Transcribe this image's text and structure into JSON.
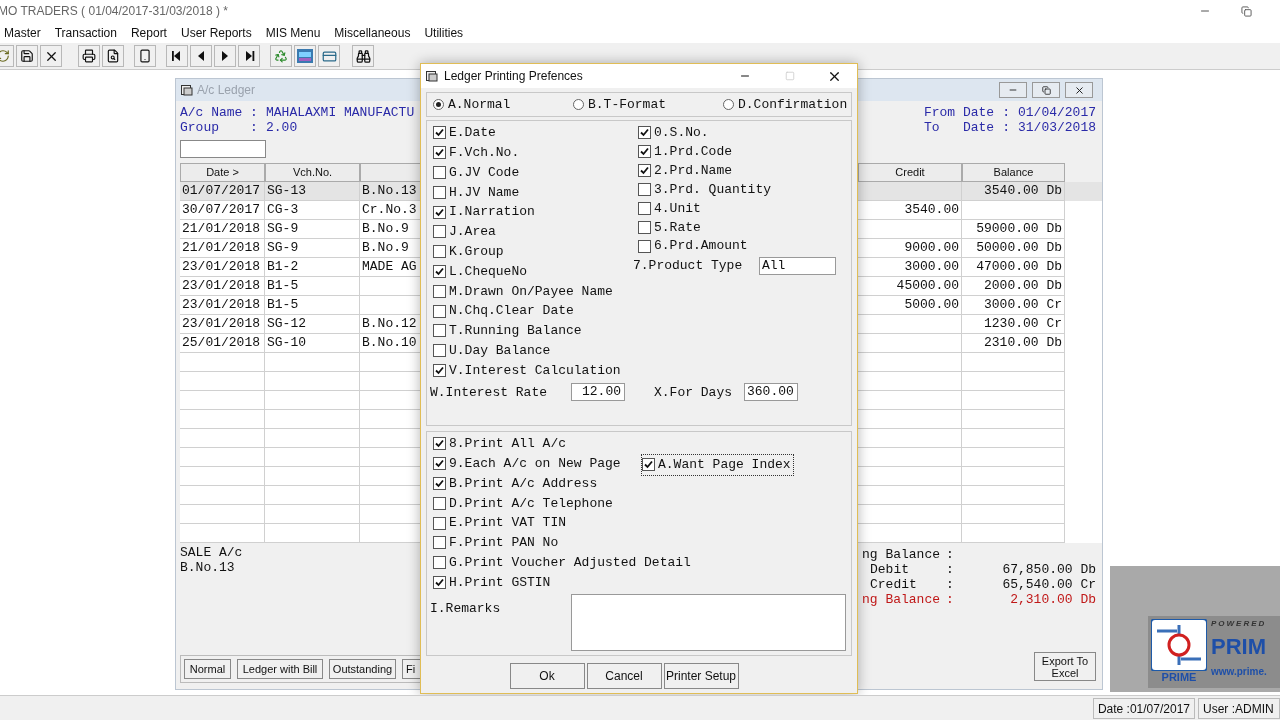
{
  "app": {
    "title": "MO TRADERS ( 01/04/2017-31/03/2018 ) *"
  },
  "menu": [
    "Master",
    "Transaction",
    "Report",
    "User Reports",
    "MIS Menu",
    "Miscellaneous",
    "Utilities"
  ],
  "ledger": {
    "title": "A/c Ledger",
    "info_left": [
      {
        "label": "A/c Name",
        "sep": ":",
        "value": "MAHALAXMI MANUFACTU"
      },
      {
        "label": "Group",
        "sep": ":",
        "value": "2.00"
      }
    ],
    "info_right": [
      {
        "label": "From Date",
        "sep": ":",
        "value": "01/04/2017"
      },
      {
        "label": "To   Date",
        "sep": ":",
        "value": "31/03/2018"
      }
    ],
    "columns": [
      {
        "label": "Date >"
      },
      {
        "label": "Vch.No."
      },
      {},
      {
        "label": "Credit"
      },
      {
        "label": "Balance"
      }
    ],
    "rows": [
      {
        "selected": true,
        "date": "01/07/2017",
        "vch_no": "SG-13",
        "column_3": "B.No.13",
        "balance": "3540.00 Db"
      },
      {
        "selected": false,
        "date": "30/07/2017",
        "vch_no": "CG-3",
        "column_3": "Cr.No.3",
        "credit": "3540.00"
      },
      {
        "selected": false,
        "date": "21/01/2018",
        "vch_no": "SG-9",
        "column_3": "B.No.9",
        "balance": "59000.00 Db"
      },
      {
        "selected": false,
        "date": "21/01/2018",
        "vch_no": "SG-9",
        "column_3": "B.No.9",
        "credit": "9000.00",
        "balance": "50000.00 Db"
      },
      {
        "selected": false,
        "date": "23/01/2018",
        "vch_no": "B1-2",
        "column_3": "MADE AG",
        "credit": "3000.00",
        "balance": "47000.00 Db"
      },
      {
        "selected": false,
        "date": "23/01/2018",
        "vch_no": "B1-5",
        "credit": "45000.00",
        "balance": "2000.00 Db"
      },
      {
        "selected": false,
        "date": "23/01/2018",
        "vch_no": "B1-5",
        "credit": "5000.00",
        "balance": "3000.00 Cr"
      },
      {
        "selected": false,
        "date": "23/01/2018",
        "vch_no": "SG-12",
        "column_3": "B.No.12",
        "balance": "1230.00 Cr"
      },
      {
        "selected": false,
        "date": "25/01/2018",
        "vch_no": "SG-10",
        "column_3": "B.No.10",
        "balance": "2310.00 Db"
      }
    ],
    "narration": [
      "SALE A/c",
      "B.No.13"
    ],
    "summary": [
      {
        "kind": "heading",
        "label": "ng Balance",
        "sep": ":"
      },
      {
        "kind": "entry",
        "label": "Debit",
        "sep": ":",
        "value": "67,850.00 Db"
      },
      {
        "kind": "entry",
        "label": "Credit",
        "sep": ":",
        "value": "65,540.00 Cr"
      },
      {
        "kind": "result",
        "label": "ng Balance",
        "sep": ":",
        "value": "2,310.00 Db"
      }
    ],
    "view_buttons": [
      "Normal",
      "Ledger with Bill",
      "Outstanding",
      "Fi"
    ],
    "export_button": "Export To Excel"
  },
  "dialog": {
    "title": "Ledger Printing Prefences",
    "formats": [
      {
        "label": "A.Normal",
        "selected": true
      },
      {
        "label": "B.T-Format",
        "selected": false
      },
      {
        "label": "D.Confirmation",
        "selected": false
      }
    ],
    "columns_left": [
      {
        "label": "E.Date",
        "checked": true
      },
      {
        "label": "F.Vch.No.",
        "checked": true
      },
      {
        "label": "G.JV Code",
        "checked": false
      },
      {
        "label": "H.JV Name",
        "checked": false
      },
      {
        "label": "I.Narration",
        "checked": true
      },
      {
        "label": "J.Area",
        "checked": false
      },
      {
        "label": "K.Group",
        "checked": false
      },
      {
        "label": "L.ChequeNo",
        "checked": true
      },
      {
        "label": "M.Drawn On/Payee Name",
        "checked": false
      },
      {
        "label": "N.Chq.Clear Date",
        "checked": false
      },
      {
        "label": "T.Running Balance",
        "checked": false
      },
      {
        "label": "U.Day Balance",
        "checked": false
      },
      {
        "label": "V.Interest Calculation",
        "checked": true
      }
    ],
    "columns_right": [
      {
        "label": "0.S.No.",
        "checked": true
      },
      {
        "label": "1.Prd.Code",
        "checked": true
      },
      {
        "label": "2.Prd.Name",
        "checked": true
      },
      {
        "label": "3.Prd. Quantity",
        "checked": false
      },
      {
        "label": "4.Unit",
        "checked": false
      },
      {
        "label": "5.Rate",
        "checked": false
      },
      {
        "label": "6.Prd.Amount",
        "checked": false
      }
    ],
    "product_type": {
      "label": "7.Product Type",
      "value": "All"
    },
    "interest_rate": {
      "label": "W.Interest Rate",
      "value": "12.00"
    },
    "for_days": {
      "label": "X.For Days",
      "value": "360.00"
    },
    "print_options": [
      {
        "label": "8.Print All A/c",
        "checked": true
      },
      {
        "label": "9.Each A/c on New Page",
        "checked": true
      },
      {
        "label": "B.Print A/c Address",
        "checked": true
      },
      {
        "label": "D.Print A/c Telephone",
        "checked": false
      },
      {
        "label": "E.Print VAT TIN",
        "checked": false
      },
      {
        "label": "F.Print PAN No",
        "checked": false
      },
      {
        "label": "G.Print Voucher Adjusted Detail",
        "checked": false
      },
      {
        "label": "H.Print GSTIN",
        "checked": true
      }
    ],
    "page_index": {
      "label": "A.Want Page Index",
      "checked": true
    },
    "remarks": {
      "label": "I.Remarks"
    },
    "buttons": [
      "Ok",
      "Cancel",
      "Printer Setup"
    ]
  },
  "logo": {
    "tagline": "POWERED",
    "name": "PRIM",
    "badge": "PRIME",
    "url": "www.prime."
  },
  "status_bar": [
    "Date :01/07/2017",
    "User :ADMIN"
  ]
}
